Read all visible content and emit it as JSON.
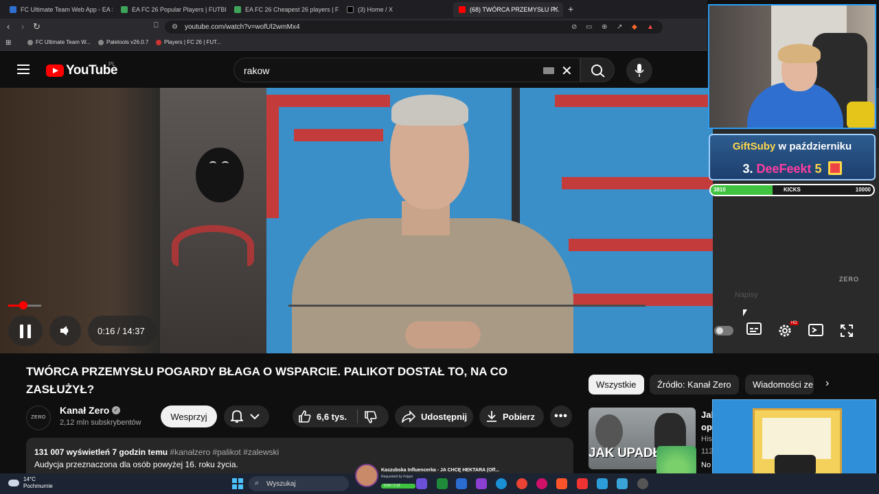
{
  "browser": {
    "tabs": [
      {
        "label": "FC Ultimate Team Web App - EA SPO",
        "color": "#2f6fcf"
      },
      {
        "label": "EA FC 26 Popular Players | FUTBIN",
        "color": "#3fa35a"
      },
      {
        "label": "EA FC 26 Cheapest 26 players | FUTB",
        "color": "#3fa35a"
      },
      {
        "label": "(3) Home / X",
        "color": "#000000"
      },
      {
        "label": "(68) TWÓRCA PRZEMYSŁU P...",
        "color": "#ff0000"
      }
    ],
    "new_tab": "+",
    "url": "youtube.com/watch?v=wofUl2wmMx4",
    "bookmarks": [
      {
        "label": "FC Ultimate Team W..."
      },
      {
        "label": "Paletools v26.0.7"
      },
      {
        "label": "Players | FC 26 | FUT..."
      }
    ],
    "extension_badge": "1"
  },
  "youtube": {
    "logo_text": "YouTube",
    "country": "PL",
    "search_value": "rakow",
    "player": {
      "current_time": "0:16",
      "duration": "14:37",
      "time_display": "0:16 / 14:37",
      "progress": 0.018,
      "watermark": "ZERO",
      "captions_hint": "Napisy",
      "hd_badge": "HD"
    },
    "video": {
      "title": "TWÓRCA PRZEMYSŁU POGARDY BŁAGA O WSPARCIE. PALIKOT DOSTAŁ TO, NA CO ZASŁUŻYŁ?",
      "channel_name": "Kanał Zero",
      "channel_avatar": "ZERO",
      "subscribers": "2,12 mln subskrybentów",
      "join_label": "Wesprzyj",
      "likes": "6,6 tys.",
      "share_label": "Udostępnij",
      "download_label": "Pobierz",
      "stats": "131 007 wyświetleń  7 godzin temu",
      "tags": "#kanałzero #palikot #zalewski",
      "description": "Audycja przeznaczona dla osób powyżej 16. roku życia."
    },
    "chips": [
      "Wszystkie",
      "Źródło: Kanał Zero",
      "Wiadomości ze"
    ],
    "recommendation": {
      "thumb_text": "JAK UPADŁY",
      "title": "Jak op",
      "meta_1": "His",
      "meta_2": "112",
      "meta_3": "No"
    }
  },
  "stream_overlay": {
    "gift_title_1": "GiftSuby",
    "gift_title_2": "w październiku",
    "gift_rank": "3.",
    "gift_name": "DeeFeekt",
    "gift_count": "5",
    "kicks_current": "3810",
    "kicks_label": "KICKS",
    "kicks_goal": "10000",
    "kicks_progress": 0.381
  },
  "now_playing": {
    "title": "Kaszubska Influencerka - JA CHCĘ HEKTARA (Off...",
    "requested_by": "Requested by Fe|per",
    "bar_text": "0:04 / 2:18"
  },
  "taskbar": {
    "temperature": "14°C",
    "weather": "Pochmurnie",
    "search_placeholder": "Wyszukaj"
  }
}
